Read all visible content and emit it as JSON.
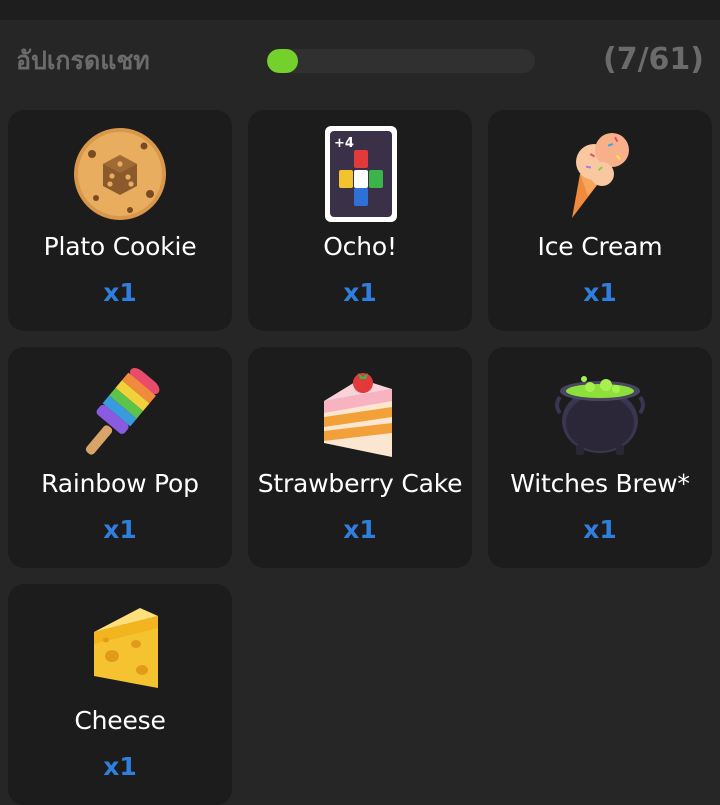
{
  "header": {
    "title": "อัปเกรดแชท",
    "count": "(7/61)",
    "progress": 0.115
  },
  "items": [
    {
      "name": "Plato Cookie",
      "qty": "x1",
      "icon": "cookie-dice-icon"
    },
    {
      "name": "Ocho!",
      "qty": "x1",
      "icon": "ocho-card-icon"
    },
    {
      "name": "Ice Cream",
      "qty": "x1",
      "icon": "ice-cream-cone-icon"
    },
    {
      "name": "Rainbow Pop",
      "qty": "x1",
      "icon": "rainbow-popsicle-icon"
    },
    {
      "name": "Strawberry Cake",
      "qty": "x1",
      "icon": "strawberry-cake-icon"
    },
    {
      "name": "Witches Brew*",
      "qty": "x1",
      "icon": "cauldron-icon"
    },
    {
      "name": "Cheese",
      "qty": "x1",
      "icon": "cheese-icon"
    }
  ],
  "colors": {
    "accent_green": "#74d12b",
    "qty_blue": "#2f7fe0"
  }
}
